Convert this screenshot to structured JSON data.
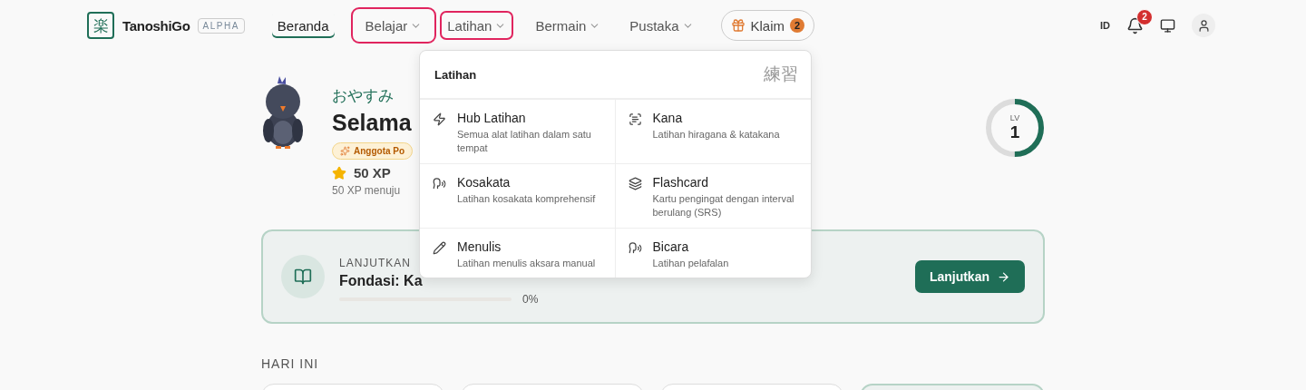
{
  "brand": {
    "logo": "楽",
    "name": "TanoshiGo",
    "badge": "ALPHA"
  },
  "nav": [
    {
      "kind": "link",
      "label": "Beranda",
      "selected": true,
      "highlighted": false
    },
    {
      "kind": "menu",
      "label": "Belajar",
      "selected": false,
      "highlighted": true
    },
    {
      "kind": "menu",
      "label": "Latihan",
      "selected": false,
      "highlighted": true
    },
    {
      "kind": "menu",
      "label": "Bermain",
      "selected": false,
      "highlighted": false
    },
    {
      "kind": "menu",
      "label": "Pustaka",
      "selected": false,
      "highlighted": false
    }
  ],
  "claim": {
    "label": "Klaim",
    "count": "2"
  },
  "header_right": {
    "language": "ID",
    "notifications": "2"
  },
  "greeting": {
    "japanese": "おやすみ",
    "title": "Selama",
    "member_badge": "Anggota Po",
    "xp": "50 XP",
    "xp_note": "50 XP menuju"
  },
  "level": {
    "label": "LV",
    "value": "1",
    "level": 0.5
  },
  "continue": {
    "eyebrow": "LANJUTKAN",
    "title": "Fondasi: Ka",
    "progress": "0%",
    "button": "Lanjutkan"
  },
  "today": {
    "heading": "HARI INI",
    "cards": [
      {
        "selected": false
      },
      {
        "selected": false
      },
      {
        "selected": false
      },
      {
        "selected": true
      }
    ]
  },
  "menu": {
    "title": "Latihan",
    "kanji": "練習",
    "items": [
      {
        "kind": "hub",
        "title": "Hub Latihan",
        "desc": "Semua alat latihan dalam satu tempat"
      },
      {
        "kind": "kana",
        "title": "Kana",
        "desc": "Latihan hiragana & katakana"
      },
      {
        "kind": "speech",
        "title": "Kosakata",
        "desc": "Latihan kosakata komprehensif"
      },
      {
        "kind": "cards",
        "title": "Flashcard",
        "desc": "Kartu pengingat dengan interval berulang (SRS)"
      },
      {
        "kind": "writing",
        "title": "Menulis",
        "desc": "Latihan menulis aksara manual"
      },
      {
        "kind": "speech",
        "title": "Bicara",
        "desc": "Latihan pelafalan"
      }
    ]
  }
}
